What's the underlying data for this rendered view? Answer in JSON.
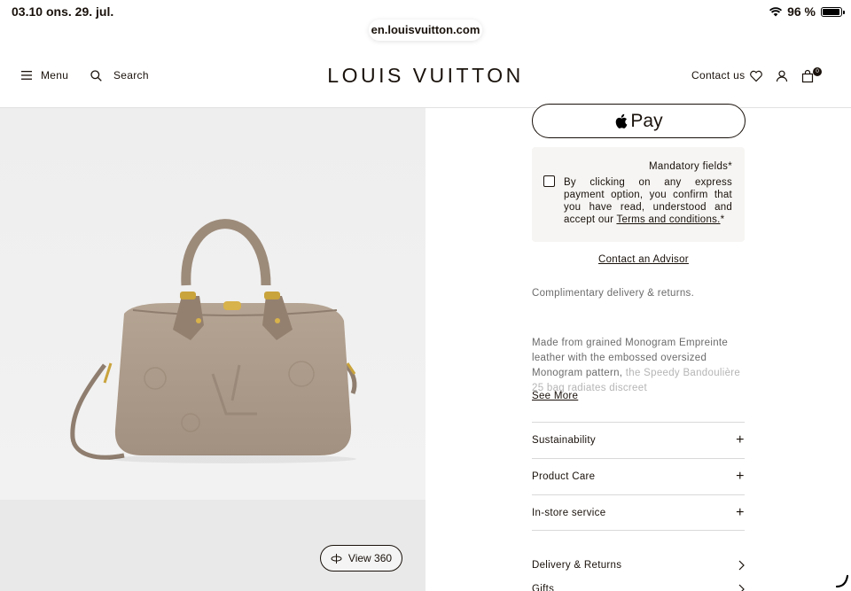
{
  "status_bar": {
    "time": "03.10",
    "date": "ons. 29. jul.",
    "battery": "96 %",
    "battery_level": 0.96
  },
  "browser": {
    "url": "en.louisvuitton.com"
  },
  "header": {
    "menu_label": "Menu",
    "search_label": "Search",
    "logo": "LOUIS VUITTON",
    "contact_label": "Contact us",
    "cart_count": "0"
  },
  "media": {
    "view360_label": "View 360"
  },
  "checkout": {
    "applepay_label": "Pay",
    "mandatory": "Mandatory fields*",
    "consent_text": "By clicking on any express payment option, you confirm that you have read, understood and accept our ",
    "terms_link": "Terms and conditions.",
    "asterisk": "*",
    "contact_advisor": "Contact an Advisor"
  },
  "product": {
    "delivery_note": "Complimentary delivery & returns.",
    "description": "Made from grained Monogram Empreinte leather with the embossed oversized Monogram pattern,",
    "description_fade": "the Speedy Bandoulière 25 bag radiates discreet",
    "see_more": "See More"
  },
  "accordion": [
    {
      "label": "Sustainability"
    },
    {
      "label": "Product Care"
    },
    {
      "label": "In-store service"
    }
  ],
  "links": [
    {
      "label": "Delivery & Returns"
    },
    {
      "label": "Gifts"
    }
  ]
}
